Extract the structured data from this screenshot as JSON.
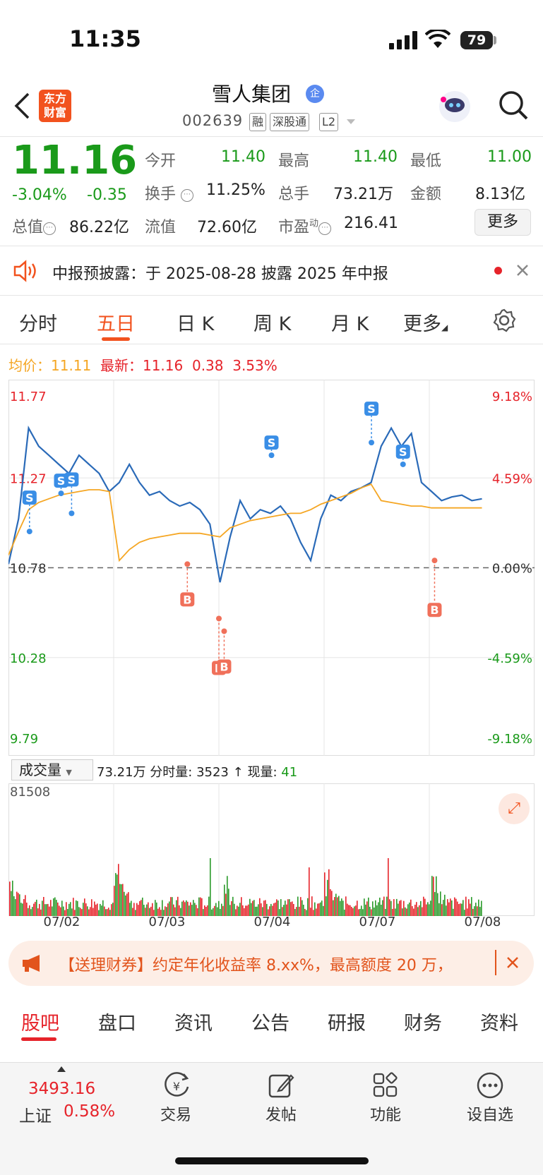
{
  "status_bar": {
    "time": "11:35",
    "battery": "79"
  },
  "header": {
    "logo_line1": "东方",
    "logo_line2": "财富",
    "title": "雪人集团",
    "title_badge": "企",
    "code": "002639",
    "tags": [
      "融",
      "深股通",
      "L2"
    ]
  },
  "quote": {
    "price": "11.16",
    "change_pct": "-3.04%",
    "change": "-0.35",
    "open_label": "今开",
    "open": "11.40",
    "high_label": "最高",
    "high": "11.40",
    "low_label": "最低",
    "low": "11.00",
    "turnover_label": "换手",
    "turnover": "11.25%",
    "volume_label": "总手",
    "volume": "73.21万",
    "amount_label": "金额",
    "amount": "8.13亿",
    "mktcap_label": "总值",
    "mktcap": "86.22亿",
    "float_label": "流值",
    "float": "72.60亿",
    "pe_label": "市盈",
    "pe_sup": "动",
    "pe": "216.41",
    "more_button": "更多"
  },
  "notice": {
    "text": "中报预披露：于 2025-08-28 披露 2025 年中报"
  },
  "chart_tabs": [
    "分时",
    "五日",
    "日 K",
    "周 K",
    "月 K",
    "更多"
  ],
  "active_chart_tab": "五日",
  "legend": {
    "avg_label": "均价：",
    "avg": "11.11",
    "latest_label": "最新：",
    "latest": "11.16",
    "delta": "0.38",
    "delta_pct": "3.53%"
  },
  "chart_data": {
    "type": "line",
    "title": "",
    "x": [
      "07/02",
      "07/03",
      "07/04",
      "07/07",
      "07/08"
    ],
    "y_ticks_left": [
      "11.77",
      "11.27",
      "10.78",
      "10.28",
      "9.79"
    ],
    "y_ticks_right": [
      "9.18%",
      "4.59%",
      "0.00%",
      "-4.59%",
      "-9.18%"
    ],
    "ylim": [
      9.79,
      11.77
    ],
    "baseline": 10.78,
    "series": [
      {
        "name": "price",
        "color": "#2a6ab8",
        "values": [
          10.8,
          11.05,
          11.55,
          11.45,
          11.4,
          11.35,
          11.3,
          11.4,
          11.35,
          11.3,
          11.2,
          11.25,
          11.35,
          11.25,
          11.18,
          11.2,
          11.15,
          11.12,
          11.14,
          11.1,
          11.02,
          10.7,
          10.95,
          11.15,
          11.05,
          11.1,
          11.08,
          11.12,
          11.05,
          10.92,
          10.82,
          11.05,
          11.18,
          11.15,
          11.2,
          11.22,
          11.25,
          11.45,
          11.55,
          11.45,
          11.52,
          11.25,
          11.2,
          11.15,
          11.17,
          11.18,
          11.15,
          11.16
        ]
      },
      {
        "name": "avg",
        "color": "#f5a623",
        "values": [
          10.85,
          10.98,
          11.1,
          11.14,
          11.16,
          11.18,
          11.19,
          11.2,
          11.21,
          11.21,
          11.2,
          10.82,
          10.88,
          10.92,
          10.94,
          10.95,
          10.96,
          10.97,
          10.97,
          10.97,
          10.96,
          10.95,
          11.0,
          11.02,
          11.04,
          11.05,
          11.06,
          11.07,
          11.08,
          11.08,
          11.1,
          11.13,
          11.15,
          11.17,
          11.19,
          11.22,
          11.24,
          11.15,
          11.14,
          11.13,
          11.12,
          11.12,
          11.11,
          11.11,
          11.11,
          11.11,
          11.11,
          11.11
        ]
      }
    ],
    "trade_markers": [
      {
        "label": "S",
        "x_frac": 0.04,
        "y": 10.98
      },
      {
        "label": "S",
        "x_frac": 0.1,
        "y": 11.19
      },
      {
        "label": "S",
        "x_frac": 0.12,
        "y": 11.08
      },
      {
        "label": "S",
        "x_frac": 0.5,
        "y": 11.4
      },
      {
        "label": "S",
        "x_frac": 0.69,
        "y": 11.47
      },
      {
        "label": "S",
        "x_frac": 0.75,
        "y": 11.35
      },
      {
        "label": "B",
        "x_frac": 0.34,
        "y": 10.8
      },
      {
        "label": "B",
        "x_frac": 0.4,
        "y": 10.5
      },
      {
        "label": "B",
        "x_frac": 0.41,
        "y": 10.43
      },
      {
        "label": "B",
        "x_frac": 0.81,
        "y": 10.82
      }
    ],
    "grid": true,
    "legend": "none"
  },
  "volume": {
    "selector": "成交量",
    "total": "73.21万",
    "tick_label": "分时量:",
    "tick_value": "3523",
    "arrow": "↑",
    "current_label": "现量:",
    "current_value": "41",
    "max": "81508"
  },
  "banner": {
    "text": "【送理财券】约定年化收益率 8.xx%，最高额度 20 万，"
  },
  "bottom_tabs": [
    "股吧",
    "盘口",
    "资讯",
    "公告",
    "研报",
    "财务",
    "资料"
  ],
  "bottom_nav": {
    "index_value": "3493.16",
    "index_name": "上证",
    "index_pct": "0.58%",
    "items": [
      "交易",
      "发帖",
      "功能",
      "设自选"
    ]
  }
}
